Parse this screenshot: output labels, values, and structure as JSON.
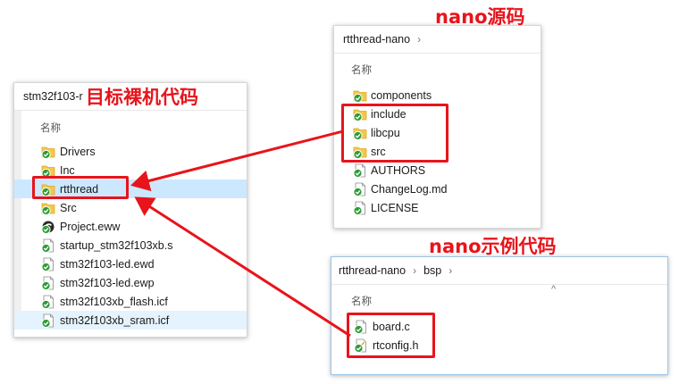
{
  "colors": {
    "accent_red": "#e8141b",
    "selection": "#cce8ff",
    "hover": "#e5f3ff",
    "folder": "#f4c84a"
  },
  "callouts": {
    "target": "目标裸机代码",
    "nano_src": "nano源码",
    "nano_example": "nano示例代码"
  },
  "left_window": {
    "breadcrumb": "stm32f103-r",
    "column_name": "名称",
    "items": [
      {
        "label": "Drivers",
        "icon": "folder-icon"
      },
      {
        "label": "Inc",
        "icon": "folder-icon"
      },
      {
        "label": "rtthread",
        "icon": "folder-icon"
      },
      {
        "label": "Src",
        "icon": "folder-icon"
      },
      {
        "label": "Project.eww",
        "icon": "workspace-icon"
      },
      {
        "label": "startup_stm32f103xb.s",
        "icon": "file-icon"
      },
      {
        "label": "stm32f103-led.ewd",
        "icon": "file-icon"
      },
      {
        "label": "stm32f103-led.ewp",
        "icon": "file-icon"
      },
      {
        "label": "stm32f103xb_flash.icf",
        "icon": "file-icon"
      },
      {
        "label": "stm32f103xb_sram.icf",
        "icon": "file-icon"
      }
    ]
  },
  "nano_window": {
    "breadcrumb": "rtthread-nano",
    "sep": "›",
    "column_name": "名称",
    "items": [
      {
        "label": "components",
        "icon": "folder-icon"
      },
      {
        "label": "include",
        "icon": "folder-icon"
      },
      {
        "label": "libcpu",
        "icon": "folder-icon"
      },
      {
        "label": "src",
        "icon": "folder-icon"
      },
      {
        "label": "AUTHORS",
        "icon": "file-icon"
      },
      {
        "label": "ChangeLog.md",
        "icon": "file-icon"
      },
      {
        "label": "LICENSE",
        "icon": "file-icon"
      }
    ]
  },
  "bsp_window": {
    "breadcrumb_root": "rtthread-nano",
    "sep": "›",
    "breadcrumb_leaf": "bsp",
    "sep2": "›",
    "sort_chevron": "^",
    "column_name": "名称",
    "items": [
      {
        "label": "board.c",
        "icon": "file-icon"
      },
      {
        "label": "rtconfig.h",
        "icon": "header-file-icon"
      }
    ]
  }
}
